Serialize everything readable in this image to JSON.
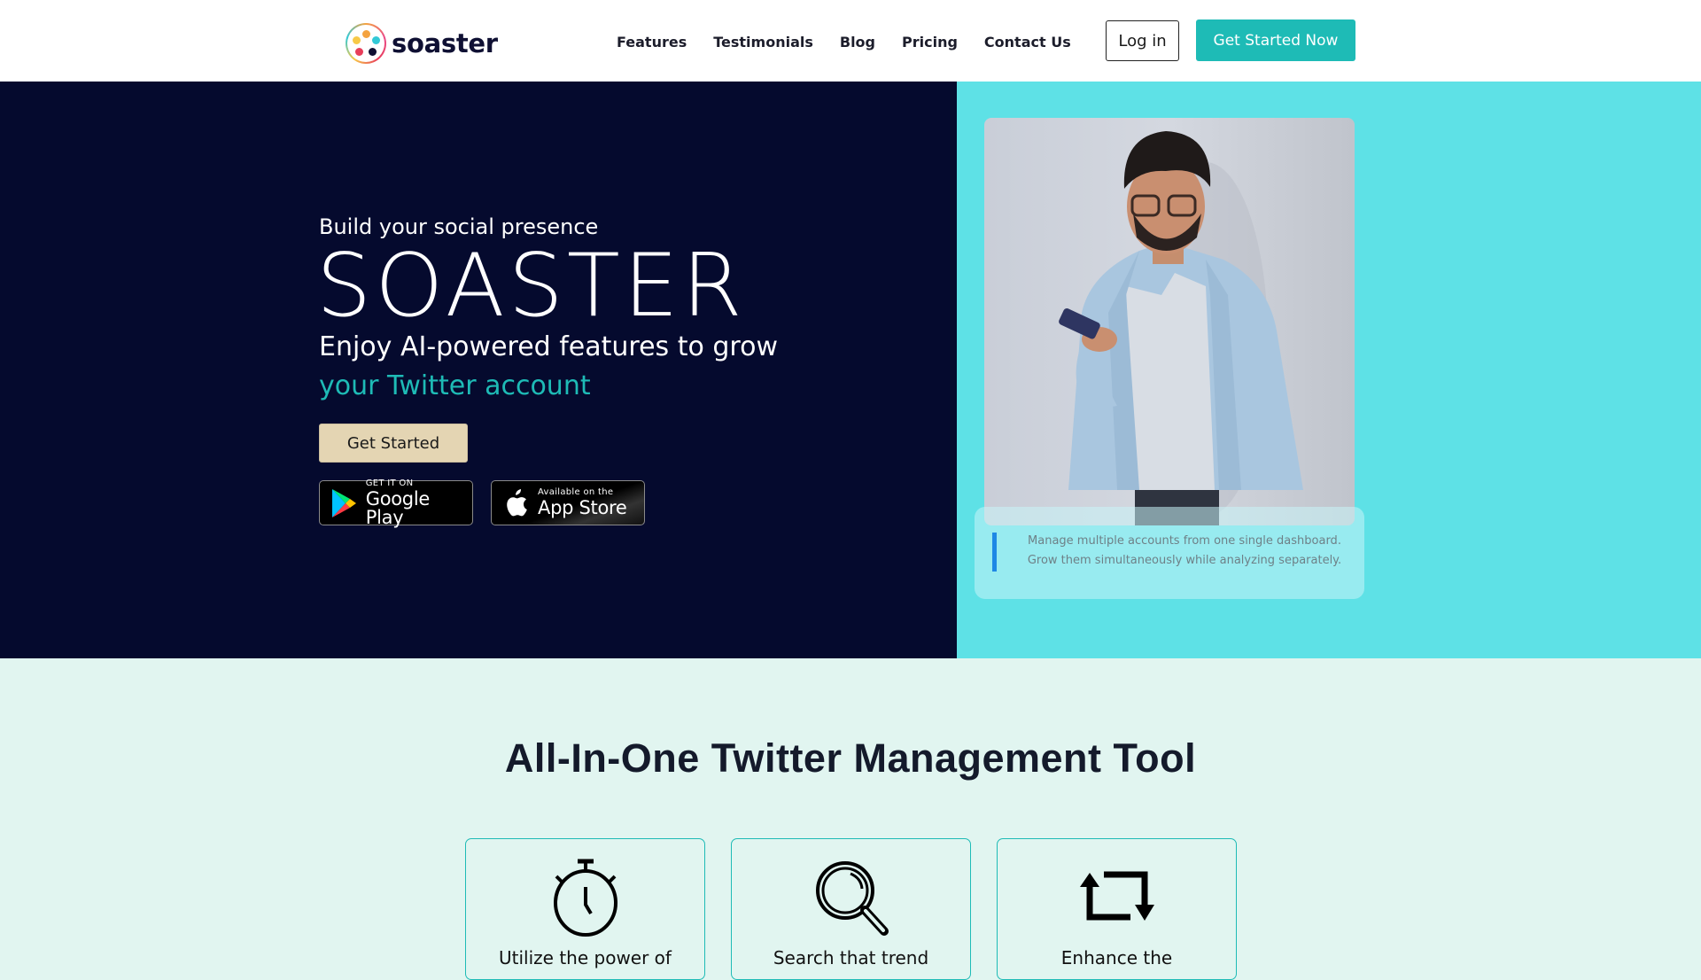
{
  "header": {
    "brand": "soaster",
    "nav": [
      "Features",
      "Testimonials",
      "Blog",
      "Pricing",
      "Contact Us"
    ],
    "login_label": "Log in",
    "cta_label": "Get Started Now"
  },
  "hero": {
    "eyebrow": "Build your social presence",
    "title": "SOASTER",
    "subtitle_line1": "Enjoy AI-powered features to grow",
    "subtitle_line2": "your Twitter account",
    "cta_label": "Get Started",
    "google_play": {
      "small": "GET IT ON",
      "large": "Google Play"
    },
    "app_store": {
      "small": "Available on the",
      "large": "App Store"
    },
    "quote_line1": "Manage multiple accounts from one single dashboard.",
    "quote_line2": "Grow them simultaneously while analyzing separately."
  },
  "colors": {
    "navy": "#050a2e",
    "teal": "#1ebbb6",
    "cyan_panel": "#5ee1e6",
    "mint_bg": "#e1f5f0",
    "beige_button": "#e4d5b3"
  },
  "features": {
    "title": "All-In-One Twitter Management Tool",
    "cards": [
      {
        "icon": "stopwatch-icon",
        "text": "Utilize the power of"
      },
      {
        "icon": "magnifier-icon",
        "text": "Search that trend"
      },
      {
        "icon": "retweet-icon",
        "text": "Enhance the"
      }
    ]
  }
}
